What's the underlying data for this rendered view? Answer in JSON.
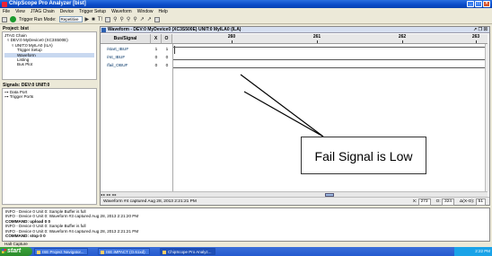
{
  "window": {
    "title": "ChipScope Pro Analyzer [bist]"
  },
  "menu": [
    "File",
    "View",
    "JTAG Chain",
    "Device",
    "Trigger Setup",
    "Waveform",
    "Window",
    "Help"
  ],
  "toolbar": {
    "trigger_run_mode_label": "Trigger Run Mode:",
    "trigger_run_mode_value": "Repetitive"
  },
  "project": {
    "title": "Project: bist",
    "tree": [
      "JTAG Chain",
      "DEV:0 MyDevice0 (XC3S500E)",
      "UNIT:0 MyILA0 (ILA)",
      "Trigger Setup",
      "Waveform",
      "Listing",
      "Bus Plot"
    ]
  },
  "signals_panel": {
    "title": "Signals: DEV:0 UNIT:0",
    "items": [
      "Data Port",
      "Trigger Ports"
    ]
  },
  "waveform": {
    "title": "Waveform - DEV:0 MyDevice0 (XC3S500E) UNIT:0 MyILA0 (ILA)",
    "controls": "↗ ❐ ☒",
    "col_bus": "Bus/Signal",
    "col_x": "X",
    "col_o": "O",
    "ticks": [
      "260",
      "261",
      "262",
      "263"
    ],
    "rows": [
      {
        "name": "/start_IBUF",
        "x": "1",
        "o": "1"
      },
      {
        "name": "/rst_IBUF",
        "x": "0",
        "o": "0"
      },
      {
        "name": "/fail_OBUF",
        "x": "0",
        "o": "0"
      }
    ],
    "status": "Waveform #4 captured Aug 28, 2013 2:21:21 PM",
    "x_label": "X:",
    "x_value": "273",
    "o_label": "O:",
    "o_value": "324",
    "delta_label": "Δ(X-O):",
    "delta_value": "51"
  },
  "annotation": {
    "text": "Fail Signal is Low"
  },
  "console": {
    "lines": [
      {
        "text": "INFO - Device 0 Unit 0: Sample Buffer is full",
        "bold": false
      },
      {
        "text": "INFO - Device 0 Unit 0: Waveform #3 captured Aug 28, 2013 2:21:20 PM",
        "bold": false
      },
      {
        "text": "COMMAND: upload 0 0",
        "bold": true
      },
      {
        "text": "INFO - Device 0 Unit 0: Sample Buffer is full",
        "bold": false
      },
      {
        "text": "INFO - Device 0 Unit 0: Waveform #4 captured Aug 28, 2013 2:21:21 PM",
        "bold": false
      },
      {
        "text": "COMMAND: stop 0 0",
        "bold": true
      }
    ]
  },
  "status_bar": "Halt Capture",
  "taskbar": {
    "start": "start",
    "tasks": [
      "ISE Project Navigator...",
      "ISE iMPACT (O.61xd)",
      "ChipScope Pro Analyz..."
    ],
    "clock": "2:22 PM"
  }
}
